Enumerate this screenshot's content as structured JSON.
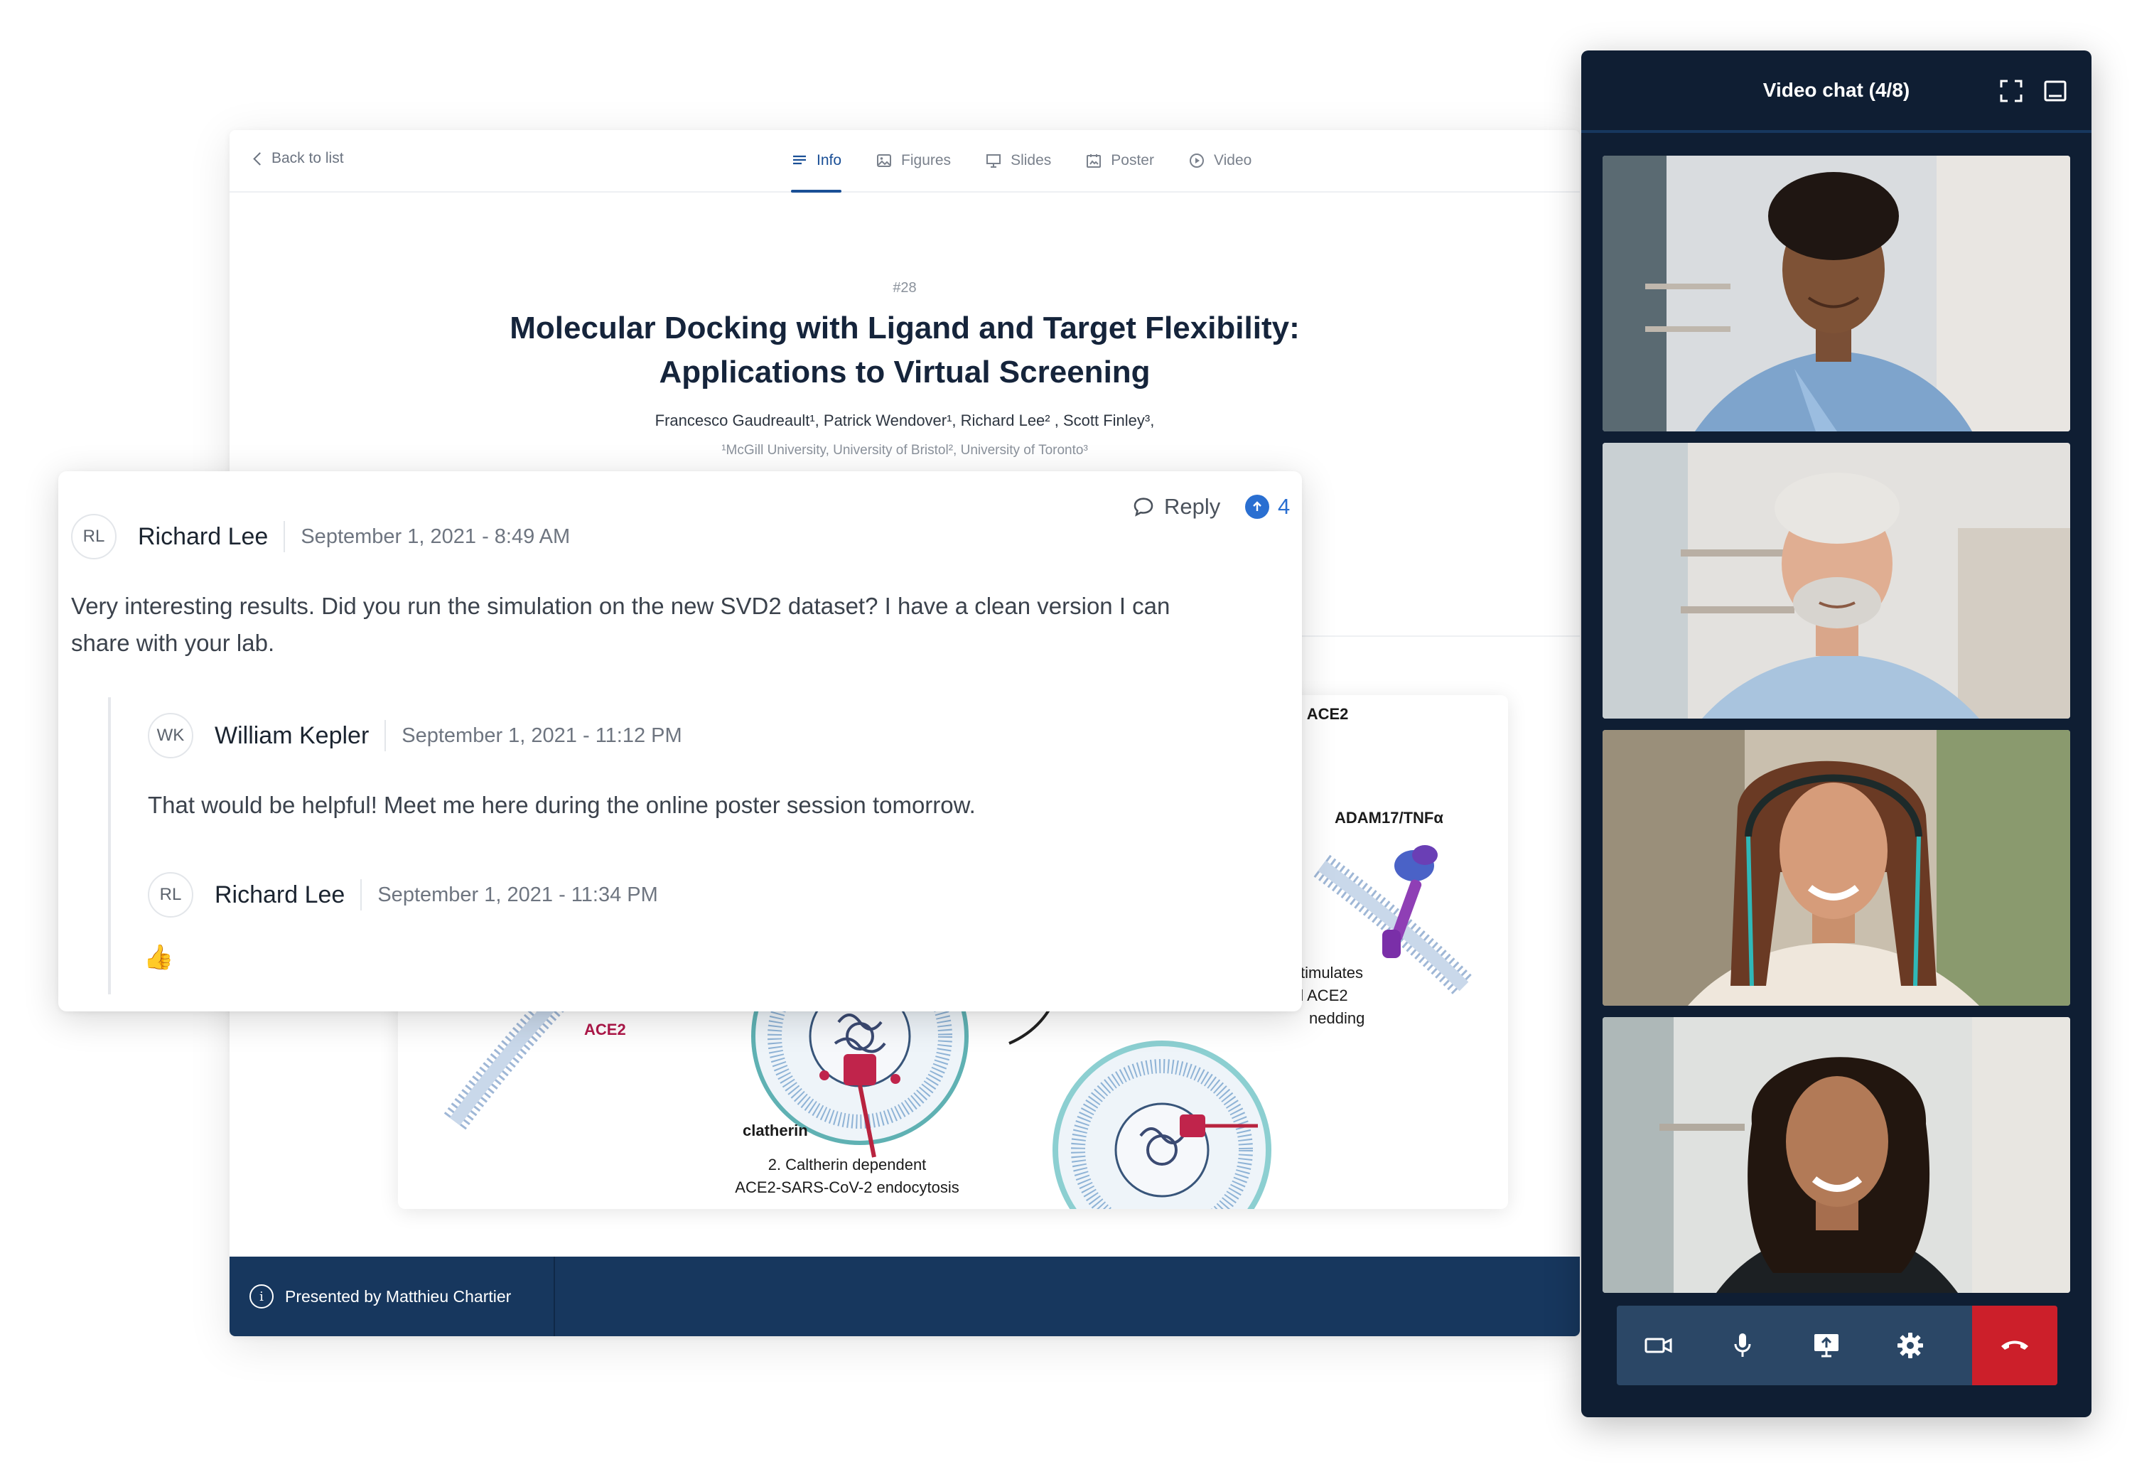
{
  "poster": {
    "back_label": "Back to list",
    "tabs": [
      {
        "label": "Info",
        "icon": "list-icon"
      },
      {
        "label": "Figures",
        "icon": "image-icon"
      },
      {
        "label": "Slides",
        "icon": "presentation-icon"
      },
      {
        "label": "Poster",
        "icon": "poster-icon"
      },
      {
        "label": "Video",
        "icon": "play-icon"
      }
    ],
    "active_tab": "Info",
    "number": "#28",
    "title_line1": "Molecular Docking with Ligand and Target Flexibility:",
    "title_line2": "Applications to Virtual Screening",
    "authors": "Francesco Gaudreault¹, Patrick Wendover¹, Richard Lee² , Scott Finley³,",
    "affiliations": "¹McGill University, University of Bristol², University of Toronto³",
    "presented_by": "Presented by Matthieu Chartier",
    "figure": {
      "label_ace2_top": "d ACE2",
      "label_adam": "ADAM17/TNFα",
      "label_stim1": "timulates",
      "label_stim2": "d ACE2",
      "label_stim3": "nedding",
      "label_ace2_left": "ACE2",
      "label_clathrin": "clatherin",
      "caption_line1": "2. Caltherin dependent",
      "caption_line2": "ACE2-SARS-CoV-2 endocytosis"
    }
  },
  "comments": {
    "main": {
      "initials": "RL",
      "author": "Richard Lee",
      "date": "September 1, 2021 - 8:49 AM",
      "body_line1": "Very interesting results. Did you run the simulation on the new SVD2 dataset? I have a clean version I can",
      "body_line2": "share with your lab.",
      "reply_label": "Reply",
      "upvotes": "4"
    },
    "replies": [
      {
        "initials": "WK",
        "author": "William Kepler",
        "date": "September 1, 2021 - 11:12 PM",
        "body": "That would be helpful! Meet me here during the online poster session tomorrow."
      },
      {
        "initials": "RL",
        "author": "Richard Lee",
        "date": "September 1, 2021 - 11:34 PM",
        "body": "👍"
      }
    ]
  },
  "video_chat": {
    "title": "Video chat (4/8)",
    "participants": 4,
    "controls": [
      "camera-icon",
      "microphone-icon",
      "screen-share-icon",
      "settings-icon",
      "hang-up-icon"
    ],
    "hangup_color": "#cc1f2a"
  },
  "colors": {
    "accent": "#1a4f96",
    "footer": "#17375e",
    "panel": "#0f1e33",
    "upvote": "#2a6fd1"
  }
}
